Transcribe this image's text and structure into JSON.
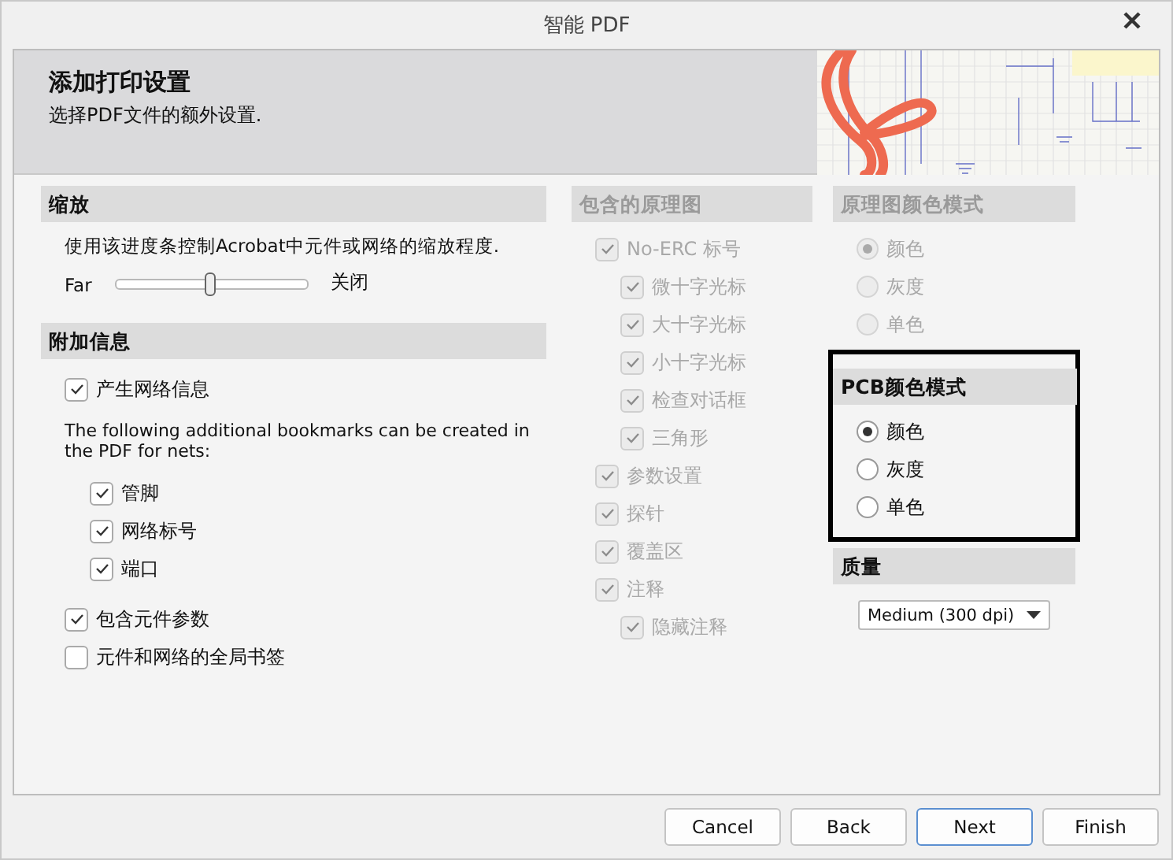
{
  "window": {
    "title": "智能 PDF"
  },
  "header": {
    "title": "添加打印设置",
    "subtitle": "选择PDF文件的额外设置."
  },
  "zoom": {
    "heading": "缩放",
    "description": "使用该进度条控制Acrobat中元件或网络的缩放程度.",
    "slider": {
      "min_label": "Far",
      "max_label": "关闭",
      "level": 0.5
    }
  },
  "additional_info": {
    "heading": "附加信息",
    "items": [
      {
        "kind": "checkbox",
        "label": "产生网络信息",
        "checked": true
      },
      {
        "kind": "note",
        "text": "The following additional bookmarks can be created in the PDF for nets:",
        "children": [
          {
            "label": "管脚",
            "checked": true
          },
          {
            "label": "网络标号",
            "checked": true
          },
          {
            "label": "端口",
            "checked": true
          }
        ]
      },
      {
        "kind": "checkbox",
        "label": "包含元件参数",
        "checked": true
      },
      {
        "kind": "checkbox",
        "label": "元件和网络的全局书签",
        "checked": false
      }
    ]
  },
  "schematics": {
    "heading": "包含的原理图",
    "disabled": true,
    "items": [
      {
        "label": "No-ERC 标号",
        "checked": true,
        "children": [
          {
            "label": "微十字光标",
            "checked": true
          },
          {
            "label": "大十字光标",
            "checked": true
          },
          {
            "label": "小十字光标",
            "checked": true
          },
          {
            "label": "检查对话框",
            "checked": true
          },
          {
            "label": "三角形",
            "checked": true
          }
        ]
      },
      {
        "label": "参数设置",
        "checked": true
      },
      {
        "label": "探针",
        "checked": true
      },
      {
        "label": "覆盖区",
        "checked": true
      },
      {
        "label": "注释",
        "checked": true,
        "children": [
          {
            "label": "隐藏注释",
            "checked": true
          }
        ]
      }
    ]
  },
  "schematic_color_mode": {
    "heading": "原理图颜色模式",
    "disabled": true,
    "options": [
      {
        "label": "颜色",
        "selected": true
      },
      {
        "label": "灰度",
        "selected": false
      },
      {
        "label": "单色",
        "selected": false
      }
    ]
  },
  "pcb_color_mode": {
    "heading": "PCB颜色模式",
    "highlighted": true,
    "options": [
      {
        "label": "颜色",
        "selected": true
      },
      {
        "label": "灰度",
        "selected": false
      },
      {
        "label": "单色",
        "selected": false
      }
    ]
  },
  "quality": {
    "heading": "质量",
    "value": "Medium (300 dpi)"
  },
  "buttons": [
    {
      "label": "Cancel",
      "focused": false
    },
    {
      "label": "Back",
      "focused": false
    },
    {
      "label": "Next",
      "focused": true
    },
    {
      "label": "Finish",
      "focused": false
    }
  ]
}
